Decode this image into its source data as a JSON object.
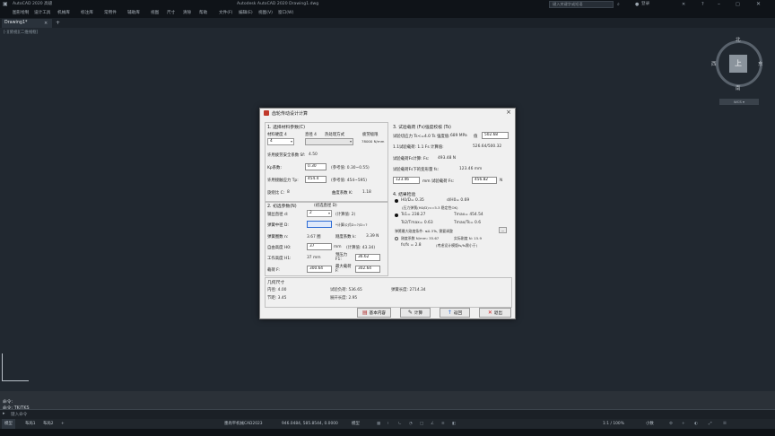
{
  "titlebar": {
    "app_label": "AutoCAD 2020 高级",
    "menu_items": [
      "图形绘制",
      "设计工具",
      "机械库",
      "标注库",
      "常用件",
      "辅助库",
      "视图",
      "尺寸",
      "清除",
      "帮助"
    ],
    "window_title": "Autodesk AutoCAD 2020    Drawing1.dwg",
    "search_placeholder": "键入关键字或短语",
    "login": "登录"
  },
  "menubar": {
    "items": [
      "文件(F)",
      "编辑(E)",
      "视图(V)",
      "插入(I)",
      "格式(O)",
      "工具(T)",
      "绘图(D)",
      "标注(N)",
      "修改(M)",
      "参数(P)",
      "窗口(W)",
      "帮助(H)"
    ]
  },
  "tabs": {
    "doc": "Drawing1*",
    "close": "×",
    "add": "+"
  },
  "viewport_label": "[-][俯视][二维线框]",
  "viewcube": {
    "top": "上",
    "north": "北",
    "south": "南",
    "east": "东",
    "west": "西",
    "wcs": "WCS ▾"
  },
  "dialog": {
    "title": "齿轮传动设计计算",
    "close": "×",
    "s1": {
      "heading": "1. 选择材料参数(C)",
      "material_label": "材料硬度 4",
      "hardness_label": "直径 4",
      "process_label": "热处理方式",
      "limit_label": "疲劳极限",
      "material_value": "4",
      "process_value": "",
      "limit_value": "78000 N/mm",
      "safety_label": "许用疲劳安全系数 Sf:",
      "safety_value": "4.50",
      "kp_label": "Kp系数:",
      "kp_value": "0.30",
      "kp_hint": "(参考值: 0.30~0.55)",
      "sigma_label": "许用接触应力 Tp:",
      "sigma_value": "454.4",
      "sigma_hint": "(参考值: 454~595)",
      "c_label": "旋绕比 C:",
      "c_value": "8",
      "k_label": "曲度系数 K:",
      "k_value": "1.18"
    },
    "s2": {
      "heading": "2. 初选参数(N)",
      "head_suffix": "(初选直径 D)",
      "wire_label": "钢丝直径 d:",
      "wire_value": "2",
      "wire_hint": "(计算值: 2)",
      "mean_label": "弹簧中径 D:",
      "mean_value": "",
      "mean_hint": "*计算公式D=?/D=?",
      "coil_label": "弹簧圈数 n:",
      "coil_value": "3.67 圈",
      "spring_k_label": "刚度系数 k:",
      "spring_k_value": "3.39 N",
      "len_label": "自由高度 H0:",
      "len_value": "37",
      "len_unit": "mm",
      "len_hint": "(计算值: 43.34)",
      "work_label": "工作高度 H1:",
      "work_value": "37 mm",
      "pre_label": "预压力 F1:",
      "pre_value": "36.62",
      "load_label": "载荷 F:",
      "load_value": "300.64",
      "load2_label": "最大载荷 F:",
      "load2_value": "302.64"
    },
    "s3": {
      "heading": "3. 试验载荷 (Fs)强度校核 (Ts)",
      "test_label": "试验切应力 Ts<=4.0 Ts 强度值:",
      "test_unit": "689 MPa",
      "test_field_label": "值",
      "test_value": "502.68",
      "limit_text": "1.1试验载荷: 1.1 Fs 计算值:",
      "limit_value": "526.64/500.32",
      "fs_label": "试验载荷Fs计算: Fs:",
      "fs_value": "493.48 N",
      "fs2_label": "试验载荷Fs下的变形量 fs:",
      "fs2_value": "123.46 mm",
      "mid_a": "123.46",
      "mid_label": "mm 试验载荷 Fs:",
      "mid_b": "456.82",
      "mid_unit": "N"
    },
    "s4": {
      "heading": "4. 结果检验",
      "r1a": "H0/D= 0.35",
      "r1b": "d/H0= 0.69",
      "r2": "(压力弹簧(H0/D)<=5.3 稳定性OK)",
      "r3a": "Ts1= 238.27",
      "r3b": "Tmax= 454.54",
      "r4a": "Ts2/Tmax= 0.63",
      "r4b": "Tmax/Ts= 0.6",
      "r5": "弹簧最大刚度条件: ≤0.3Ts, 需要调整",
      "r6a": "刚度系数 N/mm: 35.67",
      "r6b": "实际刚度 N: 15.9",
      "r7a": "fs/fs = 2.8",
      "r7b": "(考虑设计模版fs/fs需小于)"
    },
    "s5": {
      "heading": "几何尺寸",
      "g1a": "内径: 4.00",
      "g1b": "试验负荷: 536.65",
      "g1c": "弹簧长度: 2714.34",
      "g2a": "节距: 3.45",
      "g2b": "展开长度: 2.95"
    },
    "buttons": {
      "explain": "基本内容",
      "check": "计算",
      "prev": "返回",
      "cancel": "退出"
    }
  },
  "command": {
    "line1": "命令:",
    "line2": "命令: TK/TKS",
    "input_label": "键入命令"
  },
  "status": {
    "model": "模型",
    "layout1": "布局1",
    "layout2": "布局2",
    "add": "+",
    "product": "墨尚平机械CAD2023",
    "coords": "946.0484, 585.8544, 0.0000",
    "model_btn": "模型",
    "scale": "1:1 / 100%",
    "units": "小数"
  }
}
